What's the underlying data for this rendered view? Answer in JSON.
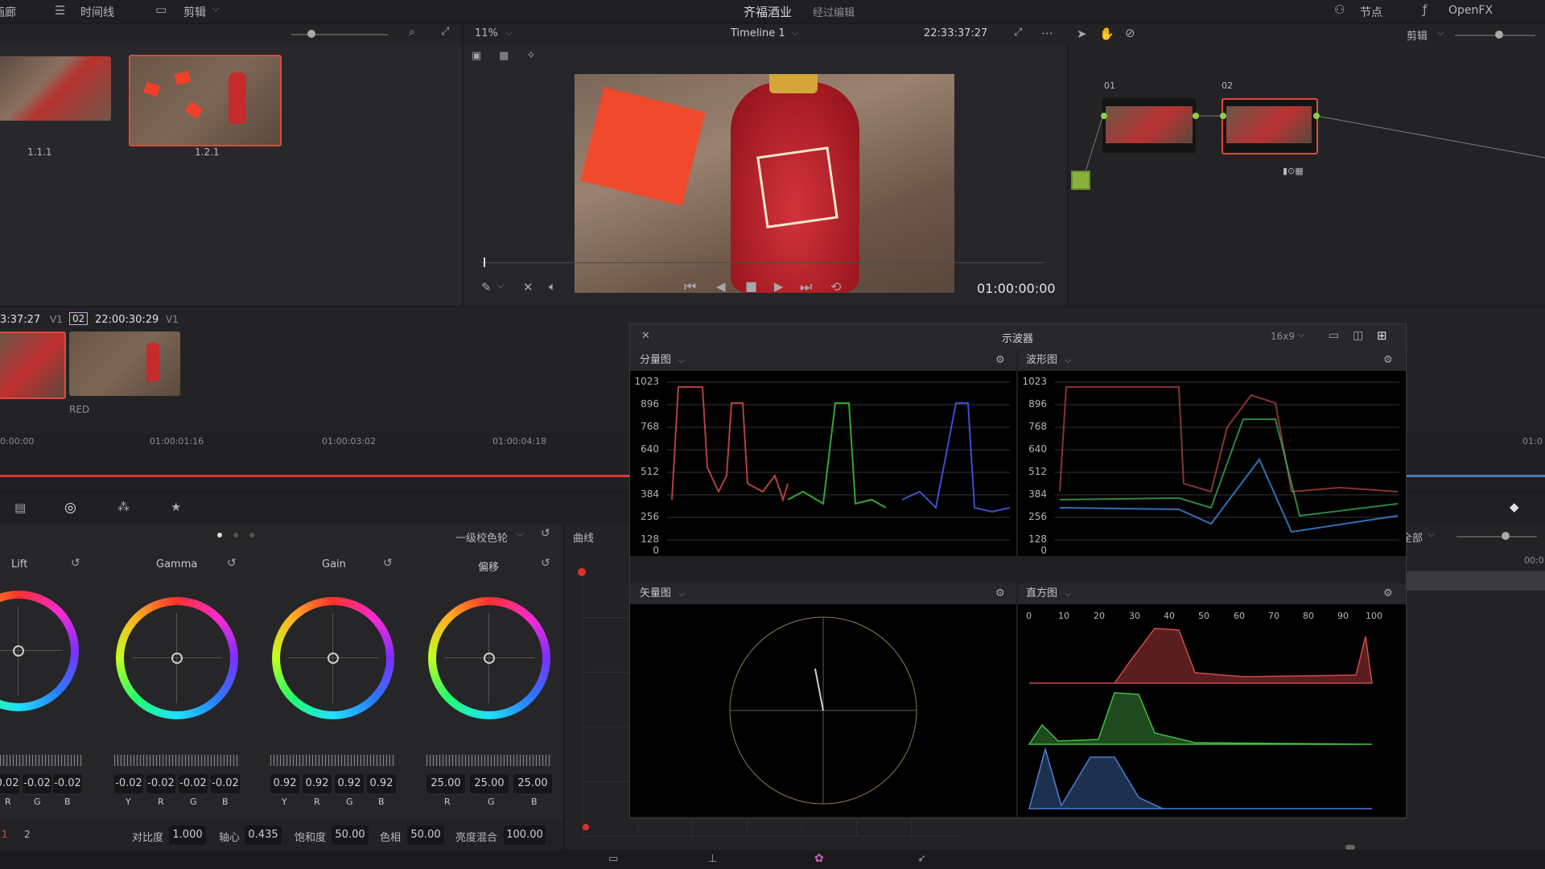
{
  "topbar": {
    "left_fragment": "画廊",
    "timeline_tab": "时间线",
    "edit_tab": "剪辑",
    "project_name": "齐福酒业",
    "project_status": "经过编辑",
    "nodes_tab": "节点",
    "openfx_tab": "OpenFX"
  },
  "viewer_bar": {
    "zoom": "11%",
    "timeline_name": "Timeline 1",
    "timecode": "22:33:37:27",
    "right_mode": "剪辑"
  },
  "gallery": {
    "clips": [
      {
        "label": "1.1.1"
      },
      {
        "label": "1.2.1"
      }
    ]
  },
  "transport": {
    "timecode": "01:00:00:00"
  },
  "nodes": {
    "items": [
      {
        "label": "01"
      },
      {
        "label": "02"
      }
    ]
  },
  "clipstrip": {
    "clip1_tc": "3:37:27",
    "clip1_track": "V1",
    "clip2_num": "02",
    "clip2_tc": "22:00:30:29",
    "clip2_track": "V1",
    "clip2_label": "RED"
  },
  "ruler": {
    "ticks": [
      "0:00:00",
      "01:00:01:16",
      "01:00:03:02",
      "01:00:04:18",
      "01:0"
    ]
  },
  "scopes": {
    "title": "示波器",
    "aspect": "16x9",
    "parade_title": "分量图",
    "waveform_title": "波形图",
    "vector_title": "矢量图",
    "hist_title": "直方图",
    "levels": [
      "1023",
      "896",
      "768",
      "640",
      "512",
      "384",
      "256",
      "128",
      "0"
    ],
    "hist_ticks": [
      "0",
      "10",
      "20",
      "30",
      "40",
      "50",
      "60",
      "70",
      "80",
      "90",
      "100"
    ]
  },
  "color": {
    "mode": "一级校色轮",
    "curves_title": "曲线",
    "all_label": "全部",
    "corner_tc": "00:0",
    "wheels": [
      {
        "name": "Lift",
        "values": [
          "0.02",
          "-0.02",
          "-0.02"
        ],
        "channels": [
          "R",
          "G",
          "B"
        ]
      },
      {
        "name": "Gamma",
        "values": [
          "-0.02",
          "-0.02",
          "-0.02",
          "-0.02"
        ],
        "channels": [
          "Y",
          "R",
          "G",
          "B"
        ]
      },
      {
        "name": "Gain",
        "values": [
          "0.92",
          "0.92",
          "0.92",
          "0.92"
        ],
        "channels": [
          "Y",
          "R",
          "G",
          "B"
        ]
      },
      {
        "name": "偏移",
        "values": [
          "25.00",
          "25.00",
          "25.00"
        ],
        "channels": [
          "R",
          "G",
          "B"
        ]
      }
    ],
    "pages": [
      "1",
      "2"
    ],
    "params": [
      {
        "label": "对比度",
        "value": "1.000"
      },
      {
        "label": "轴心",
        "value": "0.435"
      },
      {
        "label": "饱和度",
        "value": "50.00"
      },
      {
        "label": "色相",
        "value": "50.00"
      },
      {
        "label": "亮度混合",
        "value": "100.00"
      }
    ]
  }
}
